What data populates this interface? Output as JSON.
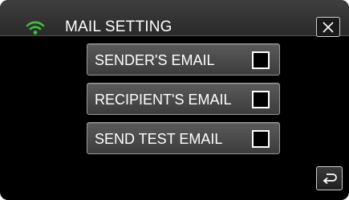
{
  "header": {
    "title": "MAIL SETTING",
    "wifi_icon": "wifi-icon",
    "wifi_color": "#3fbf3f",
    "close_icon": "close-icon"
  },
  "menu": {
    "items": [
      {
        "label": "SENDER'S EMAIL",
        "checked": false
      },
      {
        "label": "RECIPIENT'S EMAIL",
        "checked": false
      },
      {
        "label": "SEND TEST EMAIL",
        "checked": false
      }
    ]
  },
  "footer": {
    "back_icon": "return-arrow-icon"
  }
}
